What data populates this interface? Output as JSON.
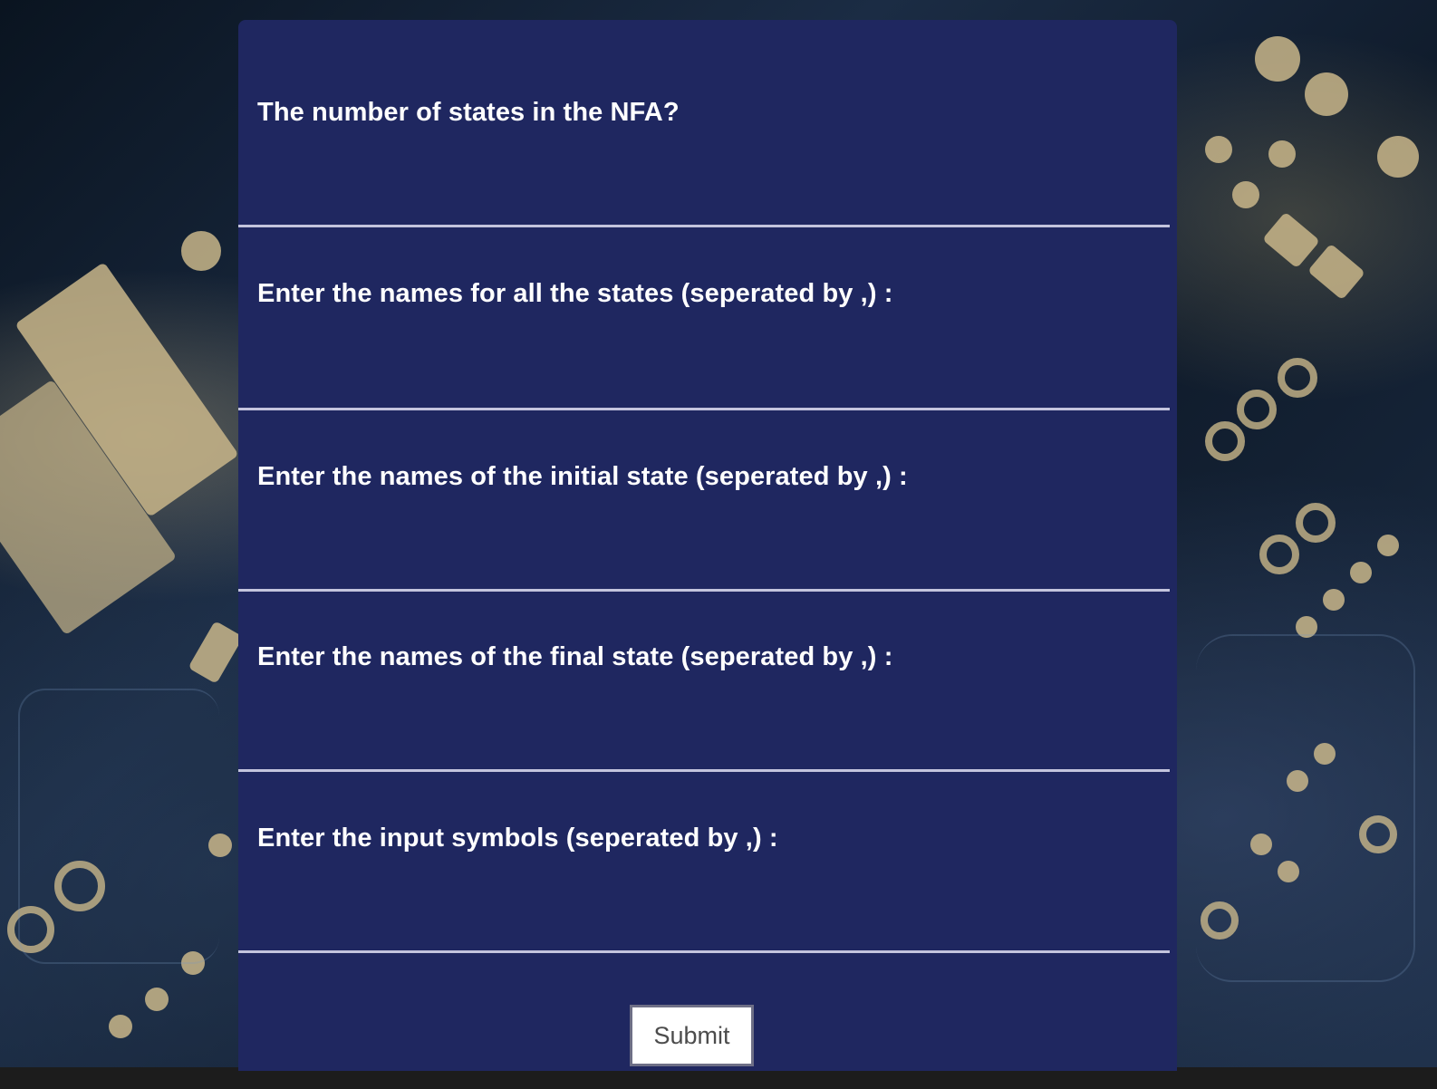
{
  "form": {
    "fields": [
      {
        "label": "The number of states in the NFA?",
        "value": ""
      },
      {
        "label": "Enter the names for all the states (seperated by ,) :",
        "value": ""
      },
      {
        "label": "Enter the names of the initial state (seperated by ,) :",
        "value": ""
      },
      {
        "label": "Enter the names of the final state (seperated by ,) :",
        "value": ""
      },
      {
        "label": "Enter the input symbols (seperated by ,) :",
        "value": ""
      }
    ],
    "submit_label": "Submit"
  },
  "colors": {
    "panel": "#1f2760",
    "field_line": "#c3c4dd",
    "label_text": "#ffffff",
    "button_bg": "#ffffff",
    "button_border": "#6e6f86",
    "button_text": "#4c4c4c"
  }
}
